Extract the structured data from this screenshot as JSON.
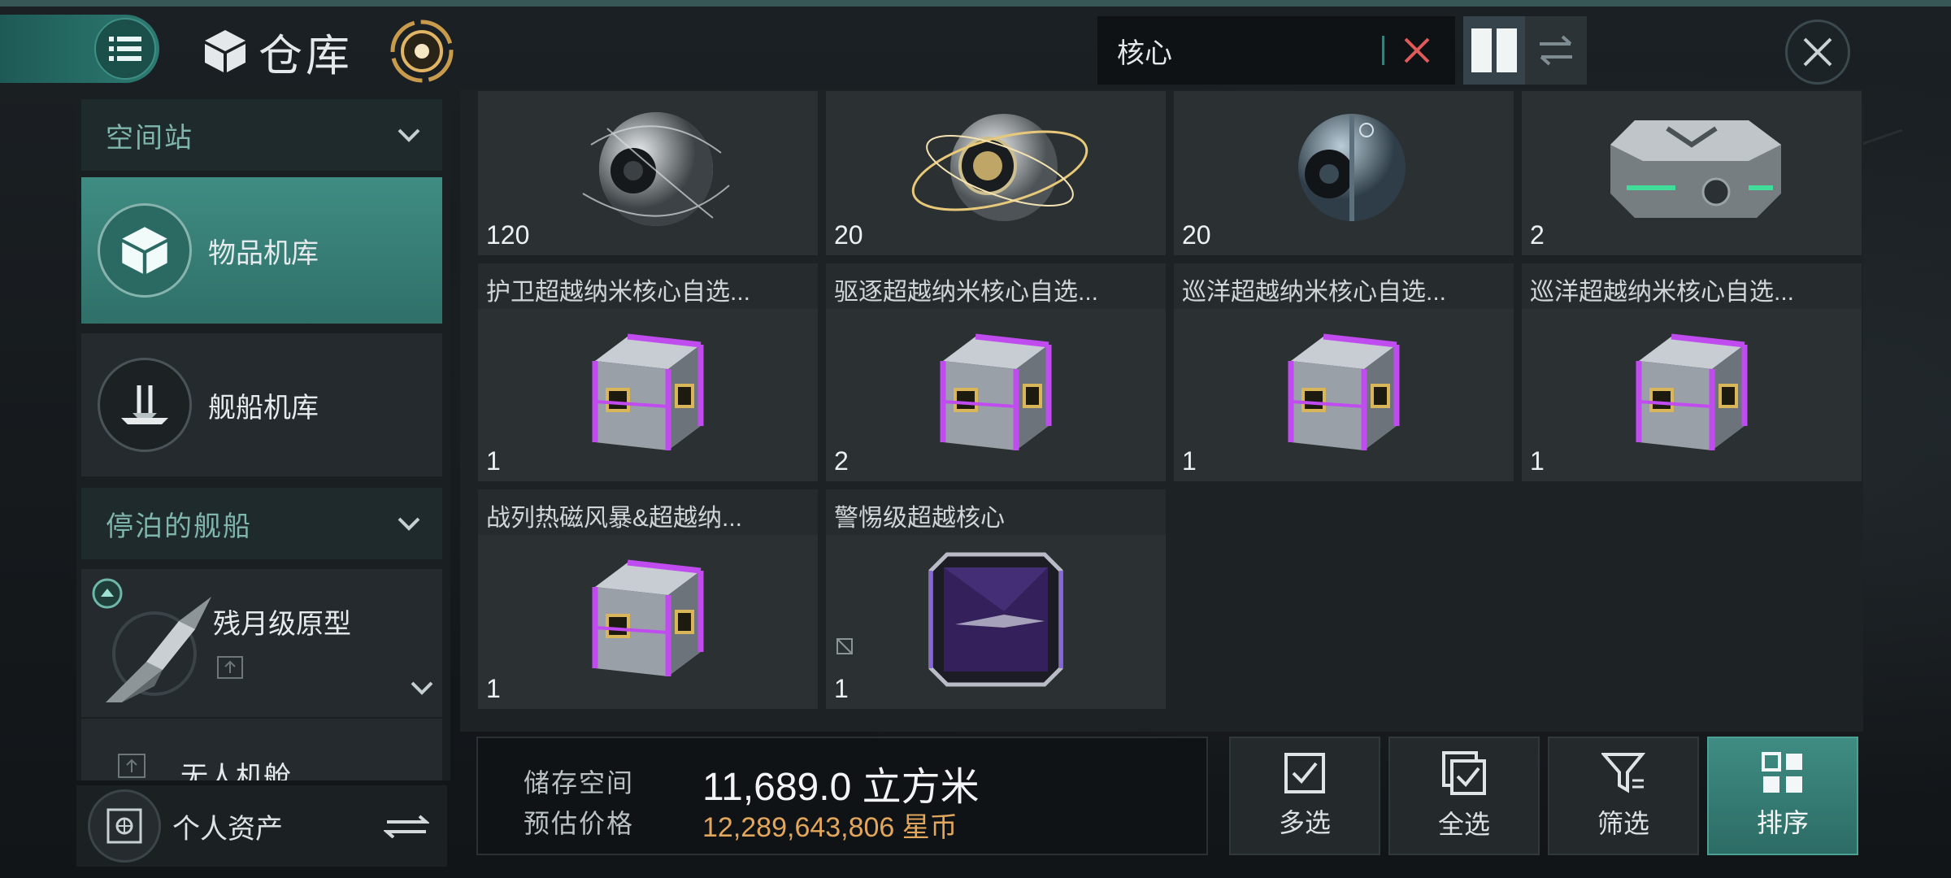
{
  "header": {
    "title": "仓库",
    "search_value": "核心"
  },
  "sidebar": {
    "section_station": "空间站",
    "item_hangar": "物品机库",
    "item_ship_hangar": "舰船机库",
    "section_docked": "停泊的舰船",
    "ship_name": "残月级原型",
    "drone_bay": "无人机舱",
    "personal_assets": "个人资产"
  },
  "items": [
    {
      "name": "",
      "qty": "120"
    },
    {
      "name": "",
      "qty": "20"
    },
    {
      "name": "",
      "qty": "20"
    },
    {
      "name": "",
      "qty": "2"
    },
    {
      "name": "护卫超越纳米核心自选...",
      "qty": "1"
    },
    {
      "name": "驱逐超越纳米核心自选...",
      "qty": "2"
    },
    {
      "name": "巡洋超越纳米核心自选...",
      "qty": "1"
    },
    {
      "name": "巡洋超越纳米核心自选...",
      "qty": "1"
    },
    {
      "name": "战列热磁风暴&超越纳...",
      "qty": "1"
    },
    {
      "name": "警惕级超越核心",
      "qty": "1"
    }
  ],
  "storage": {
    "space_label": "储存空间",
    "space_value": "11,689.0 立方米",
    "price_label": "预估价格",
    "price_value": "12,289,643,806 星币"
  },
  "actions": {
    "multi_select": "多选",
    "select_all": "全选",
    "filter": "筛选",
    "sort": "排序"
  },
  "colors": {
    "accent": "#3f8c83",
    "price": "#e2a75c",
    "crate_glow": "#c04cf0"
  }
}
